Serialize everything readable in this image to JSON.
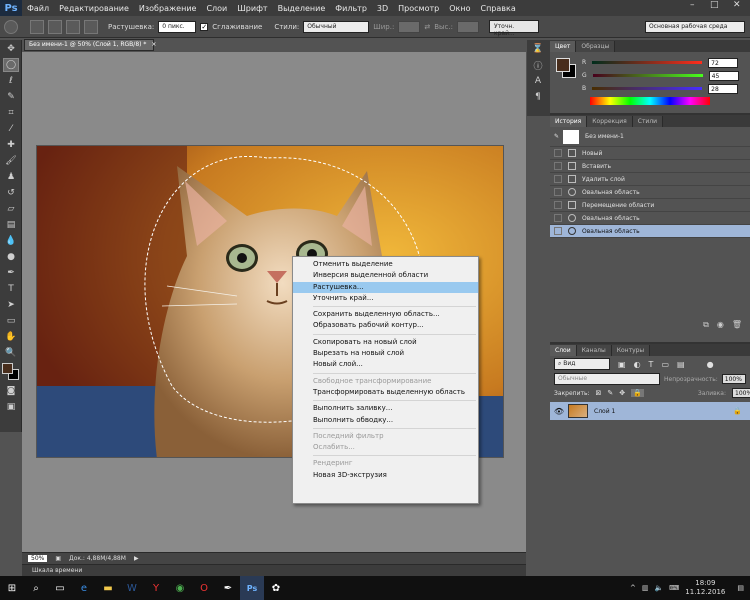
{
  "app": {
    "logo": "Ps"
  },
  "menu": [
    "Файл",
    "Редактирование",
    "Изображение",
    "Слои",
    "Шрифт",
    "Выделение",
    "Фильтр",
    "3D",
    "Просмотр",
    "Окно",
    "Справка"
  ],
  "window_controls": {
    "minimize": "–",
    "maximize": "□",
    "close": "✕"
  },
  "options": {
    "feather_label": "Растушевка:",
    "feather_value": "0 пикс.",
    "antialias_label": "Сглаживание",
    "style_label": "Стили:",
    "style_value": "Обычный",
    "width_label": "Шир.:",
    "height_label": "Выс.:",
    "refine_button": "Уточн. край...",
    "workspace": "Основная рабочая среда"
  },
  "document": {
    "tab_title": "Без имени-1 @ 50% (Слой 1, RGB/8) *",
    "close": "×"
  },
  "status": {
    "zoom": "50%",
    "doc_size": "Док.: 4,88M/4,88M"
  },
  "timeline_label": "Шкала времени",
  "color_panel": {
    "tabs": [
      "Цвет",
      "Образцы"
    ],
    "r_label": "R",
    "r": "72",
    "g_label": "G",
    "g": "45",
    "b_label": "B",
    "b": "28",
    "swatch_color": "#482d1c"
  },
  "history_panel": {
    "tabs": [
      "История",
      "Коррекция",
      "Стили"
    ],
    "snapshot": "Без имени-1",
    "items": [
      "Новый",
      "Вставить",
      "Удалить слой",
      "Овальная область",
      "Перемещение области",
      "Овальная область",
      "Овальная область"
    ]
  },
  "layers_panel": {
    "tabs": [
      "Слои",
      "Каналы",
      "Контуры"
    ],
    "filter": "Вид",
    "blend": "Обычные",
    "opacity_label": "Непрозрачность:",
    "opacity": "100%",
    "lock_label": "Закрепить:",
    "fill_label": "Заливка:",
    "fill": "100%",
    "layer_name": "Слой 1"
  },
  "context_menu": {
    "groups": [
      [
        {
          "t": "Отменить выделение",
          "d": false
        },
        {
          "t": "Инверсия выделенной области",
          "d": false
        },
        {
          "t": "Растушевка...",
          "d": false,
          "hl": true
        },
        {
          "t": "Уточнить край...",
          "d": false
        }
      ],
      [
        {
          "t": "Сохранить выделенную область...",
          "d": false
        },
        {
          "t": "Образовать рабочий контур...",
          "d": false
        }
      ],
      [
        {
          "t": "Скопировать на новый слой",
          "d": false
        },
        {
          "t": "Вырезать на новый слой",
          "d": false
        },
        {
          "t": "Новый слой...",
          "d": false
        }
      ],
      [
        {
          "t": "Свободное трансформирование",
          "d": true
        },
        {
          "t": "Трансформировать выделенную область",
          "d": false
        }
      ],
      [
        {
          "t": "Выполнить заливку...",
          "d": false
        },
        {
          "t": "Выполнить обводку...",
          "d": false
        }
      ],
      [
        {
          "t": "Последний фильтр",
          "d": true
        },
        {
          "t": "Ослабить...",
          "d": true
        }
      ],
      [
        {
          "t": "Рендеринг",
          "d": true
        },
        {
          "t": "Новая 3D-экструзия",
          "d": false
        }
      ]
    ]
  },
  "taskbar": {
    "time": "18:09",
    "date": "11.12.2016"
  }
}
